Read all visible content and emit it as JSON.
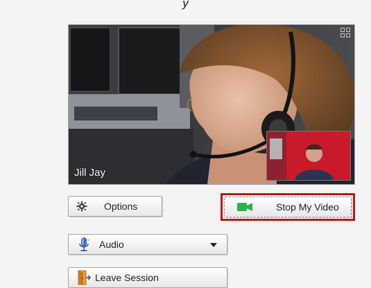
{
  "header": {
    "partial_title": "y"
  },
  "video": {
    "caller_name": "Jill Jay"
  },
  "controls": {
    "options_label": "Options",
    "stop_video_label": "Stop My Video",
    "audio_label": "Audio",
    "leave_label": "Leave  Session"
  },
  "icons": {
    "options": "gear-icon",
    "stop_video": "video-camera-icon",
    "audio": "microphone-icon",
    "leave": "exit-door-icon",
    "fullscreen": "fullscreen-icon",
    "dropdown": "chevron-down-icon"
  },
  "colors": {
    "highlight_border": "#c31616",
    "camera_icon": "#2bb24c",
    "pip_background": "#c81a2a"
  }
}
